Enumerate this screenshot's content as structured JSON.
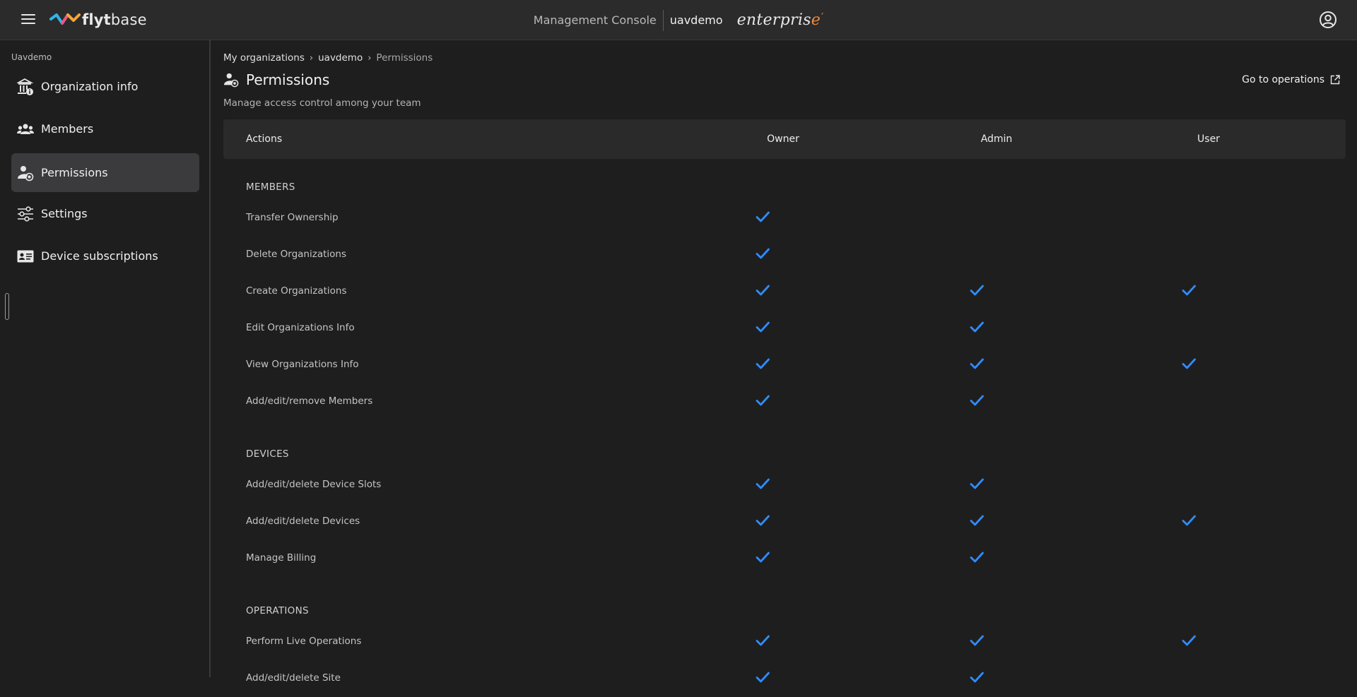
{
  "header": {
    "brand_bold": "flyt",
    "brand_light": "base",
    "console_title": "Management Console",
    "org_name": "uavdemo",
    "edition_main": "enterpris",
    "edition_accent": "e"
  },
  "sidebar": {
    "org_label": "Uavdemo",
    "items": [
      {
        "label": "Organization info",
        "icon": "bank-info-icon",
        "active": false
      },
      {
        "label": "Members",
        "icon": "group-icon",
        "active": false
      },
      {
        "label": "Permissions",
        "icon": "user-shield-icon",
        "active": true
      },
      {
        "label": "Settings",
        "icon": "sliders-icon",
        "active": false
      },
      {
        "label": "Device subscriptions",
        "icon": "id-card-icon",
        "active": false
      }
    ]
  },
  "breadcrumb": {
    "items": [
      "My organizations",
      "uavdemo",
      "Permissions"
    ],
    "separator": "›"
  },
  "page": {
    "title": "Permissions",
    "subtitle": "Manage access control among your team",
    "goto_label": "Go to operations"
  },
  "table": {
    "columns": [
      "Actions",
      "Owner",
      "Admin",
      "User"
    ],
    "sections": [
      {
        "title": "MEMBERS",
        "rows": [
          {
            "label": "Transfer Ownership",
            "owner": true,
            "admin": false,
            "user": false
          },
          {
            "label": "Delete Organizations",
            "owner": true,
            "admin": false,
            "user": false
          },
          {
            "label": "Create Organizations",
            "owner": true,
            "admin": true,
            "user": true
          },
          {
            "label": "Edit Organizations Info",
            "owner": true,
            "admin": true,
            "user": false
          },
          {
            "label": "View Organizations Info",
            "owner": true,
            "admin": true,
            "user": true
          },
          {
            "label": "Add/edit/remove Members",
            "owner": true,
            "admin": true,
            "user": false
          }
        ]
      },
      {
        "title": "DEVICES",
        "rows": [
          {
            "label": "Add/edit/delete Device Slots",
            "owner": true,
            "admin": true,
            "user": false
          },
          {
            "label": "Add/edit/delete Devices",
            "owner": true,
            "admin": true,
            "user": true
          },
          {
            "label": "Manage Billing",
            "owner": true,
            "admin": true,
            "user": false
          }
        ]
      },
      {
        "title": "OPERATIONS",
        "rows": [
          {
            "label": "Perform Live Operations",
            "owner": true,
            "admin": true,
            "user": true
          },
          {
            "label": "Add/edit/delete Site",
            "owner": true,
            "admin": true,
            "user": false
          }
        ]
      }
    ]
  },
  "colors": {
    "check": "#2f8cff",
    "background": "#1e1e1f",
    "topbar": "#2b2b2c",
    "active_item": "#3b3b3d",
    "accent_orange": "#f08a3c"
  }
}
